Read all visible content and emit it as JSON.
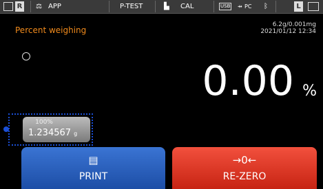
{
  "status_bar": {
    "r_label": "R",
    "app_label": "APP",
    "ptest_label": "P-TEST",
    "cal_label": "CAL",
    "usb_label": "USB",
    "pc_label": "PC",
    "l_label": "L"
  },
  "header": {
    "title": "Percent weighing",
    "capacity": "6.2g/0.001mg",
    "datetime": "2021/01/12  12:34"
  },
  "display": {
    "value": "0.00",
    "unit": "%"
  },
  "reference": {
    "percent": "100%",
    "value": "1.234567",
    "unit": "g"
  },
  "buttons": {
    "print_label": "PRINT",
    "print_icon": "print-icon",
    "rezero_label": "RE-ZERO",
    "rezero_glyph": "→0←"
  },
  "colors": {
    "title": "#f08a1c",
    "print": "#2a62c0",
    "rezero": "#e03c29",
    "highlight": "#1b4fd6"
  }
}
